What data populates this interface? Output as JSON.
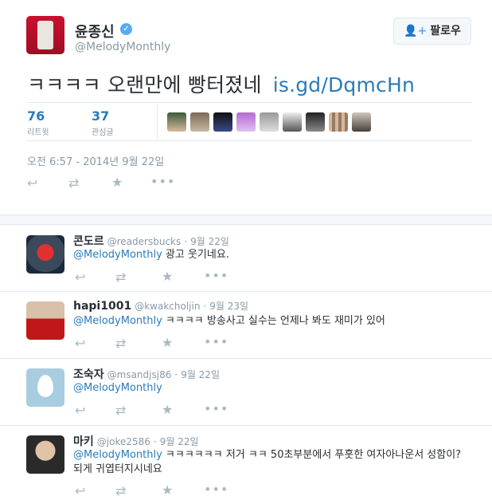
{
  "main_tweet": {
    "name": "윤종신",
    "handle": "@MelodyMonthly",
    "follow_label": "팔로우",
    "text": "ㅋㅋㅋㅋ 오랜만에 빵터졌네",
    "link": "is.gd/DqmcHn",
    "retweets_count": "76",
    "retweets_label": "리트윗",
    "favorites_count": "37",
    "favorites_label": "관심글",
    "timestamp": "오전 6:57 - 2014년 9월 22일"
  },
  "replies": [
    {
      "name": "콘도르",
      "handle": "@readersbucks",
      "date": "9월 22일",
      "mention": "@MelodyMonthly",
      "text": "광고 웃기네요."
    },
    {
      "name": "hapi1001",
      "handle": "@kwakcholjin",
      "date": "9월 23일",
      "mention": "@MelodyMonthly",
      "text": "ㅋㅋㅋㅋ 방송사고 실수는 언제나 봐도 재미가 있어"
    },
    {
      "name": "조숙자",
      "handle": "@msandjsj86",
      "date": "9월 22일",
      "mention": "@MelodyMonthly",
      "text": ""
    },
    {
      "name": "마키",
      "handle": "@joke2586",
      "date": "9월 22일",
      "mention": "@MelodyMonthly",
      "text": "ㅋㅋㅋㅋㅋㅋ  저거 ㅋㅋ 50초부분에서 푸훗한 여자아나운서 성함이? 되게 귀엽터지시네요"
    }
  ],
  "icons": {
    "reply": "reply-icon",
    "retweet": "retweet-icon",
    "favorite": "star-icon",
    "more": "more-icon",
    "verified": "verified-badge-icon",
    "follow": "add-user-icon"
  },
  "colors": {
    "link": "#2b7bb9",
    "muted": "#8899a6",
    "action": "#aab8c2",
    "verified": "#55acee"
  }
}
